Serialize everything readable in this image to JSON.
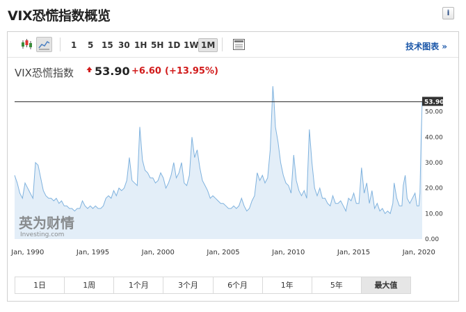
{
  "page": {
    "title": "VIX恐慌指数概览",
    "info_label": "i"
  },
  "toolbar": {
    "intervals": [
      "1",
      "5",
      "15",
      "30",
      "1H",
      "5H",
      "1D",
      "1W",
      "1M"
    ],
    "selected_interval": "1M",
    "tech_chart_link": "技术图表 »"
  },
  "quote": {
    "name": "VIX恐慌指数",
    "price": "53.90",
    "change": "+6.60",
    "change_pct": "(+13.95%)",
    "up_color": "#d11b1b"
  },
  "watermark": {
    "brand": "英为财情",
    "sub": "Investing.com"
  },
  "chart_data": {
    "type": "area",
    "x_tick_labels": [
      "Jan, 1990",
      "Jan, 1995",
      "Jan, 2000",
      "Jan, 2005",
      "Jan, 2010",
      "Jan, 2015",
      "Jan, 2020"
    ],
    "y_tick_labels": [
      "0.00",
      "10.00",
      "20.00",
      "30.00",
      "40.00",
      "50.00"
    ],
    "ylim": [
      0,
      60
    ],
    "xlim": [
      1989.0,
      2020.25
    ],
    "current_value": 53.9,
    "current_label": "53.90",
    "line_color": "#7fb2de",
    "fill_color": "#e3eef8",
    "grid": false,
    "points": [
      [
        1989.0,
        25
      ],
      [
        1989.2,
        22
      ],
      [
        1989.4,
        18
      ],
      [
        1989.6,
        16
      ],
      [
        1989.8,
        22
      ],
      [
        1990.0,
        20
      ],
      [
        1990.2,
        18
      ],
      [
        1990.4,
        16
      ],
      [
        1990.6,
        30
      ],
      [
        1990.8,
        29
      ],
      [
        1991.0,
        24
      ],
      [
        1991.2,
        19
      ],
      [
        1991.4,
        17
      ],
      [
        1991.6,
        16
      ],
      [
        1991.8,
        16
      ],
      [
        1992.0,
        15
      ],
      [
        1992.2,
        16
      ],
      [
        1992.4,
        14
      ],
      [
        1992.6,
        15
      ],
      [
        1992.8,
        13
      ],
      [
        1993.0,
        13
      ],
      [
        1993.2,
        12
      ],
      [
        1993.4,
        12
      ],
      [
        1993.6,
        11
      ],
      [
        1993.8,
        12
      ],
      [
        1994.0,
        12
      ],
      [
        1994.2,
        15
      ],
      [
        1994.4,
        13
      ],
      [
        1994.6,
        12
      ],
      [
        1994.8,
        13
      ],
      [
        1995.0,
        12
      ],
      [
        1995.2,
        13
      ],
      [
        1995.4,
        12
      ],
      [
        1995.6,
        12
      ],
      [
        1995.8,
        13
      ],
      [
        1996.0,
        16
      ],
      [
        1996.2,
        17
      ],
      [
        1996.4,
        16
      ],
      [
        1996.6,
        19
      ],
      [
        1996.8,
        17
      ],
      [
        1997.0,
        20
      ],
      [
        1997.2,
        19
      ],
      [
        1997.4,
        20
      ],
      [
        1997.6,
        23
      ],
      [
        1997.8,
        32
      ],
      [
        1998.0,
        23
      ],
      [
        1998.2,
        22
      ],
      [
        1998.4,
        21
      ],
      [
        1998.6,
        44
      ],
      [
        1998.8,
        31
      ],
      [
        1999.0,
        27
      ],
      [
        1999.2,
        26
      ],
      [
        1999.4,
        24
      ],
      [
        1999.6,
        24
      ],
      [
        1999.8,
        22
      ],
      [
        2000.0,
        23
      ],
      [
        2000.2,
        26
      ],
      [
        2000.4,
        24
      ],
      [
        2000.6,
        20
      ],
      [
        2000.8,
        22
      ],
      [
        2001.0,
        25
      ],
      [
        2001.2,
        30
      ],
      [
        2001.4,
        24
      ],
      [
        2001.6,
        26
      ],
      [
        2001.8,
        30
      ],
      [
        2002.0,
        22
      ],
      [
        2002.2,
        21
      ],
      [
        2002.4,
        25
      ],
      [
        2002.6,
        40
      ],
      [
        2002.8,
        32
      ],
      [
        2003.0,
        35
      ],
      [
        2003.2,
        28
      ],
      [
        2003.4,
        23
      ],
      [
        2003.6,
        21
      ],
      [
        2003.8,
        19
      ],
      [
        2004.0,
        16
      ],
      [
        2004.2,
        17
      ],
      [
        2004.4,
        16
      ],
      [
        2004.6,
        15
      ],
      [
        2004.8,
        14
      ],
      [
        2005.0,
        14
      ],
      [
        2005.2,
        13
      ],
      [
        2005.4,
        12
      ],
      [
        2005.6,
        12
      ],
      [
        2005.8,
        13
      ],
      [
        2006.0,
        12
      ],
      [
        2006.2,
        13
      ],
      [
        2006.4,
        16
      ],
      [
        2006.6,
        13
      ],
      [
        2006.8,
        11
      ],
      [
        2007.0,
        12
      ],
      [
        2007.2,
        15
      ],
      [
        2007.4,
        17
      ],
      [
        2007.6,
        26
      ],
      [
        2007.8,
        23
      ],
      [
        2008.0,
        25
      ],
      [
        2008.2,
        22
      ],
      [
        2008.4,
        24
      ],
      [
        2008.6,
        35
      ],
      [
        2008.8,
        60
      ],
      [
        2008.9,
        53
      ],
      [
        2009.0,
        44
      ],
      [
        2009.2,
        38
      ],
      [
        2009.4,
        30
      ],
      [
        2009.6,
        25
      ],
      [
        2009.8,
        22
      ],
      [
        2010.0,
        21
      ],
      [
        2010.2,
        18
      ],
      [
        2010.4,
        33
      ],
      [
        2010.6,
        23
      ],
      [
        2010.8,
        19
      ],
      [
        2011.0,
        17
      ],
      [
        2011.2,
        19
      ],
      [
        2011.4,
        16
      ],
      [
        2011.6,
        43
      ],
      [
        2011.8,
        30
      ],
      [
        2012.0,
        20
      ],
      [
        2012.2,
        17
      ],
      [
        2012.4,
        20
      ],
      [
        2012.6,
        16
      ],
      [
        2012.8,
        16
      ],
      [
        2013.0,
        14
      ],
      [
        2013.2,
        13
      ],
      [
        2013.4,
        17
      ],
      [
        2013.6,
        14
      ],
      [
        2013.8,
        14
      ],
      [
        2014.0,
        15
      ],
      [
        2014.2,
        13
      ],
      [
        2014.4,
        11
      ],
      [
        2014.6,
        16
      ],
      [
        2014.8,
        15
      ],
      [
        2015.0,
        18
      ],
      [
        2015.2,
        14
      ],
      [
        2015.4,
        14
      ],
      [
        2015.6,
        28
      ],
      [
        2015.8,
        18
      ],
      [
        2016.0,
        22
      ],
      [
        2016.2,
        14
      ],
      [
        2016.4,
        19
      ],
      [
        2016.6,
        12
      ],
      [
        2016.8,
        14
      ],
      [
        2017.0,
        11
      ],
      [
        2017.2,
        12
      ],
      [
        2017.4,
        10
      ],
      [
        2017.6,
        11
      ],
      [
        2017.8,
        10
      ],
      [
        2018.0,
        14
      ],
      [
        2018.1,
        22
      ],
      [
        2018.3,
        16
      ],
      [
        2018.5,
        13
      ],
      [
        2018.7,
        13
      ],
      [
        2018.8,
        21
      ],
      [
        2018.95,
        25
      ],
      [
        2019.1,
        16
      ],
      [
        2019.3,
        14
      ],
      [
        2019.5,
        16
      ],
      [
        2019.7,
        18
      ],
      [
        2019.85,
        13
      ],
      [
        2020.0,
        13
      ],
      [
        2020.08,
        18
      ],
      [
        2020.17,
        40
      ],
      [
        2020.25,
        53.9
      ]
    ]
  }
}
